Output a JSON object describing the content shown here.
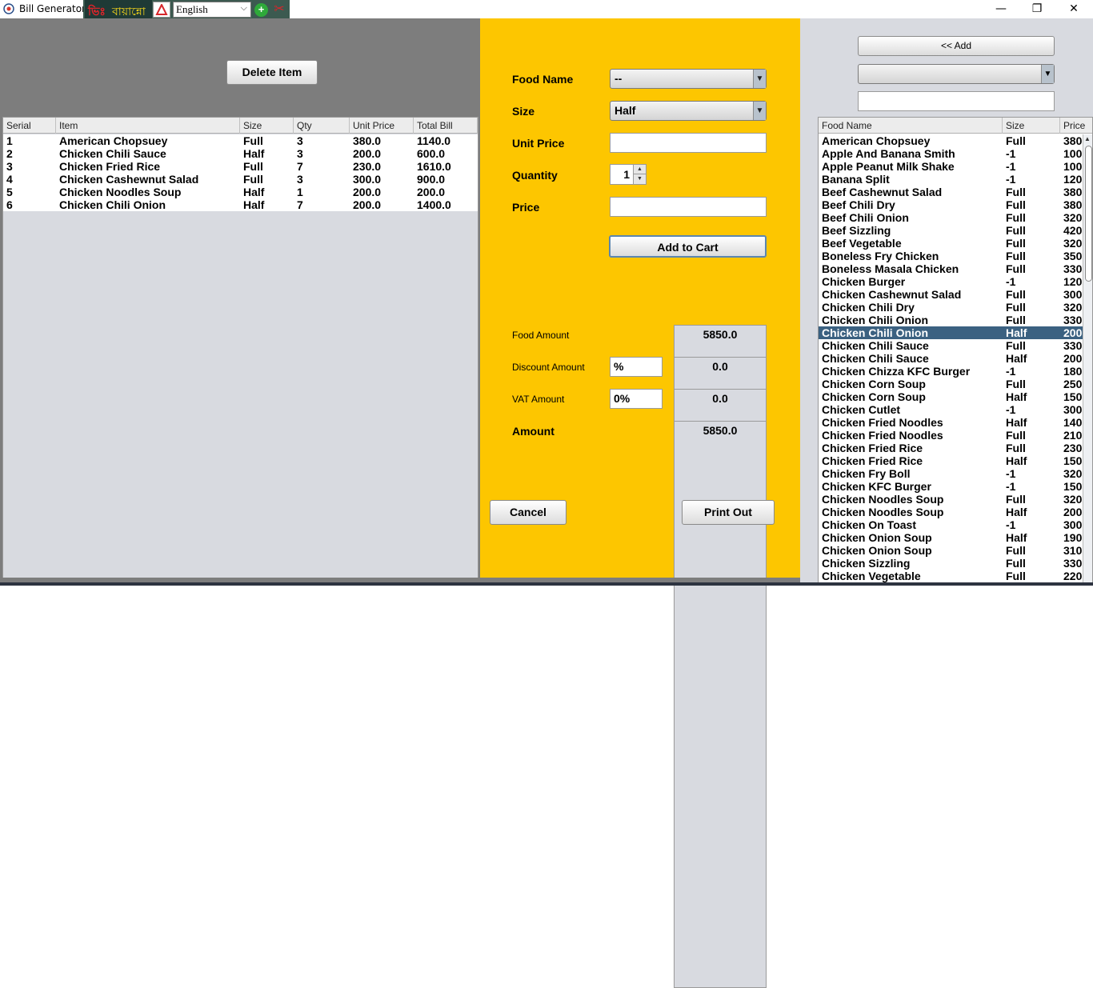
{
  "window": {
    "title": "Bill Generator",
    "ime_logo_glyph": "ভিঃ",
    "ime_name": "বায়ান্নো",
    "ime_language": "English",
    "ime_add_glyph": "+",
    "ime_tool_glyph": "✂",
    "min_glyph": "—",
    "max_glyph": "❐",
    "close_glyph": "✕"
  },
  "left": {
    "delete_label": "Delete Item",
    "columns": [
      "Serial",
      "Item",
      "Size",
      "Qty",
      "Unit Price",
      "Total Bill"
    ],
    "rows": [
      [
        "1",
        "American Chopsuey",
        "Full",
        "3",
        "380.0",
        "1140.0"
      ],
      [
        "2",
        "Chicken Chili Sauce",
        "Half",
        "3",
        "200.0",
        "600.0"
      ],
      [
        "3",
        "Chicken Fried Rice",
        "Full",
        "7",
        "230.0",
        "1610.0"
      ],
      [
        "4",
        "Chicken Cashewnut Salad",
        "Full",
        "3",
        "300.0",
        "900.0"
      ],
      [
        "5",
        "Chicken Noodles Soup",
        "Half",
        "1",
        "200.0",
        "200.0"
      ],
      [
        "6",
        "Chicken Chili Onion",
        "Half",
        "7",
        "200.0",
        "1400.0"
      ]
    ]
  },
  "form": {
    "food_name_label": "Food Name",
    "food_name_value": "--",
    "size_label": "Size",
    "size_value": "Half",
    "unit_price_label": "Unit Price",
    "unit_price_value": "",
    "quantity_label": "Quantity",
    "quantity_value": "1",
    "price_label": "Price",
    "price_value": "",
    "add_to_cart_label": "Add to Cart",
    "food_amount_label": "Food Amount",
    "food_amount_value": "5850.0",
    "discount_label": "Discount Amount",
    "discount_percent": "%",
    "discount_value": "0.0",
    "vat_label": "VAT Amount",
    "vat_percent": "0%",
    "vat_value": "0.0",
    "amount_label": "Amount",
    "amount_value": "5850.0",
    "cancel_label": "Cancel",
    "print_label": "Print Out"
  },
  "right": {
    "add_label": "<< Add",
    "columns": [
      "Food Name",
      "Size",
      "Price"
    ],
    "selected_index": 15,
    "rows": [
      [
        "American Chopsuey",
        "Full",
        "380"
      ],
      [
        "Apple And Banana Smith",
        "-1",
        "100"
      ],
      [
        "Apple Peanut Milk Shake",
        "-1",
        "100"
      ],
      [
        "Banana Split",
        "-1",
        "120"
      ],
      [
        "Beef Cashewnut Salad",
        "Full",
        "380"
      ],
      [
        "Beef Chili Dry",
        "Full",
        "380"
      ],
      [
        "Beef Chili Onion",
        "Full",
        "320"
      ],
      [
        "Beef Sizzling",
        "Full",
        "420"
      ],
      [
        "Beef Vegetable",
        "Full",
        "320"
      ],
      [
        "Boneless Fry Chicken",
        "Full",
        "350"
      ],
      [
        "Boneless Masala Chicken",
        "Full",
        "330"
      ],
      [
        "Chicken Burger",
        "-1",
        "120"
      ],
      [
        "Chicken Cashewnut Salad",
        "Full",
        "300"
      ],
      [
        "Chicken Chili Dry",
        "Full",
        "320"
      ],
      [
        "Chicken Chili Onion",
        "Full",
        "330"
      ],
      [
        "Chicken Chili Onion",
        "Half",
        "200"
      ],
      [
        "Chicken Chili Sauce",
        "Full",
        "330"
      ],
      [
        "Chicken Chili Sauce",
        "Half",
        "200"
      ],
      [
        "Chicken Chizza KFC Burger",
        "-1",
        "180"
      ],
      [
        "Chicken Corn Soup",
        "Full",
        "250"
      ],
      [
        "Chicken Corn Soup",
        "Half",
        "150"
      ],
      [
        "Chicken Cutlet",
        "-1",
        "300"
      ],
      [
        "Chicken Fried Noodles",
        "Half",
        "140"
      ],
      [
        "Chicken Fried Noodles",
        "Full",
        "210"
      ],
      [
        "Chicken Fried Rice",
        "Full",
        "230"
      ],
      [
        "Chicken Fried Rice",
        "Half",
        "150"
      ],
      [
        "Chicken Fry Boll",
        "-1",
        "320"
      ],
      [
        "Chicken KFC Burger",
        "-1",
        "150"
      ],
      [
        "Chicken Noodles Soup",
        "Full",
        "320"
      ],
      [
        "Chicken Noodles Soup",
        "Half",
        "200"
      ],
      [
        "Chicken On Toast",
        "-1",
        "300"
      ],
      [
        "Chicken Onion Soup",
        "Half",
        "190"
      ],
      [
        "Chicken Onion Soup",
        "Full",
        "310"
      ],
      [
        "Chicken Sizzling",
        "Full",
        "330"
      ],
      [
        "Chicken Vegetable",
        "Full",
        "220"
      ]
    ]
  }
}
